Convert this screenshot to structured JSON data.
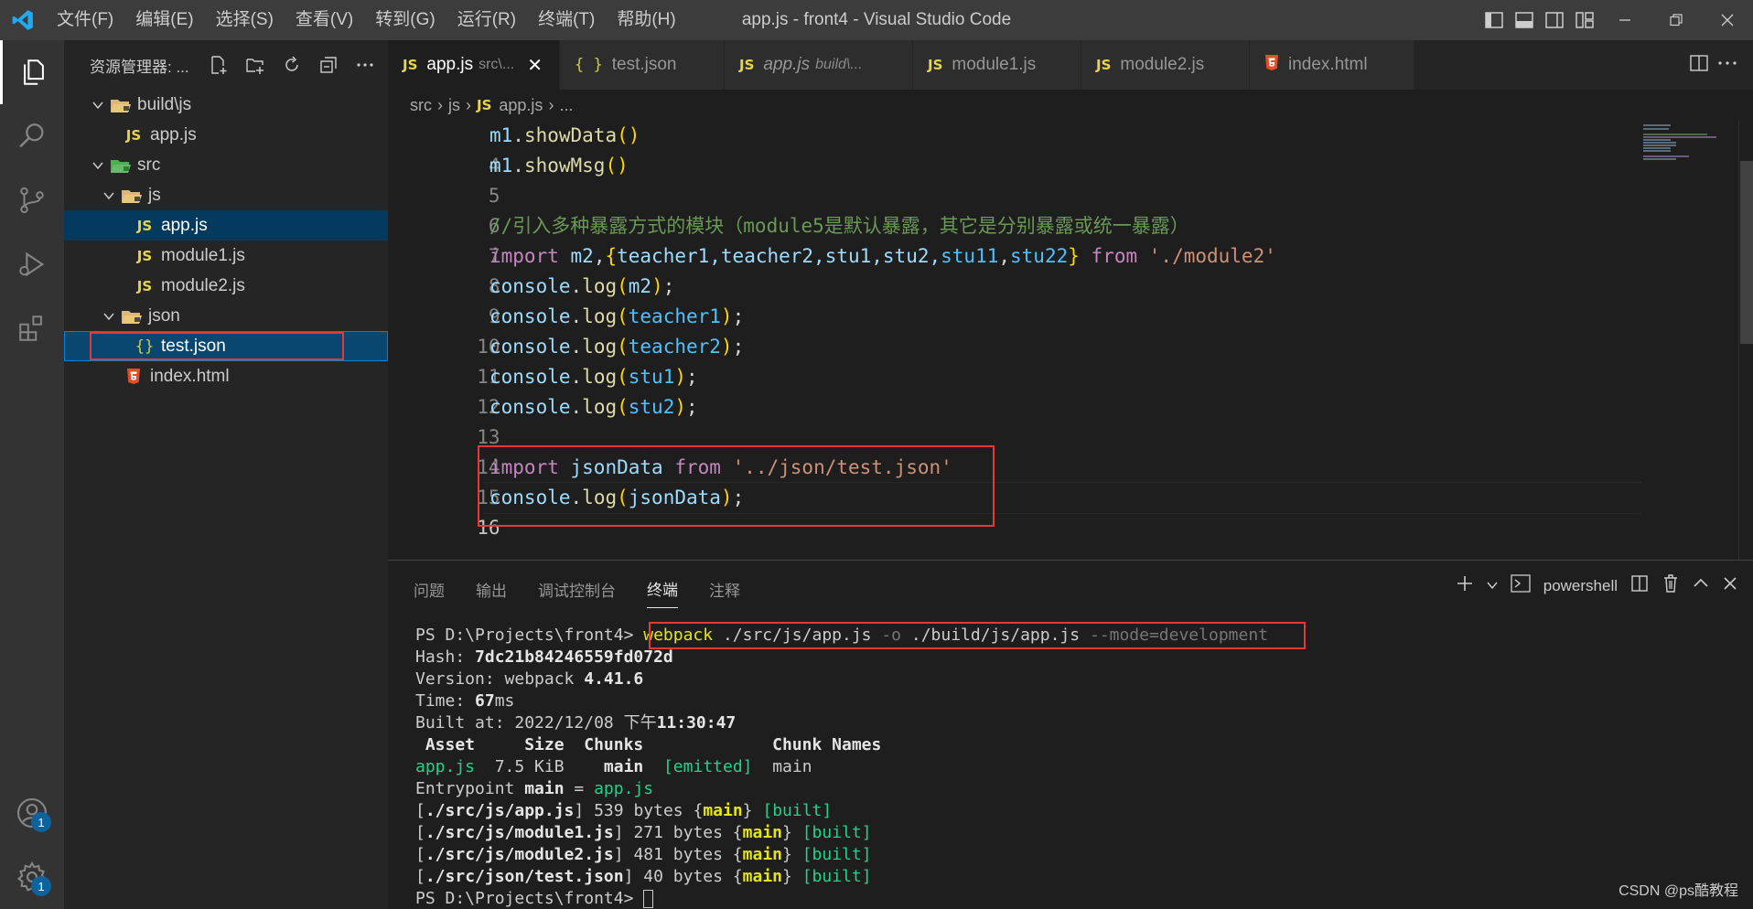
{
  "window": {
    "title": "app.js - front4 - Visual Studio Code"
  },
  "menu": [
    "文件(F)",
    "编辑(E)",
    "选择(S)",
    "查看(V)",
    "转到(G)",
    "运行(R)",
    "终端(T)",
    "帮助(H)"
  ],
  "activity": {
    "accounts_badge": "1",
    "settings_badge": "1"
  },
  "explorer": {
    "title": "资源管理器: ...",
    "tree": [
      {
        "label": "build\\js",
        "kind": "folder",
        "expanded": true
      },
      {
        "label": "app.js",
        "kind": "js"
      },
      {
        "label": "src",
        "kind": "folder",
        "expanded": true
      },
      {
        "label": "js",
        "kind": "folder",
        "expanded": true
      },
      {
        "label": "app.js",
        "kind": "js",
        "state": "selected"
      },
      {
        "label": "module1.js",
        "kind": "js"
      },
      {
        "label": "module2.js",
        "kind": "js"
      },
      {
        "label": "json",
        "kind": "folder",
        "expanded": true
      },
      {
        "label": "test.json",
        "kind": "json",
        "state": "focused"
      },
      {
        "label": "index.html",
        "kind": "html"
      }
    ]
  },
  "tabs": [
    {
      "icon": "JS",
      "name": "app.js",
      "desc": "src\\...",
      "active": true,
      "close": "✕"
    },
    {
      "icon": "{ }",
      "name": "test.json",
      "desc": ""
    },
    {
      "icon": "JS",
      "name": "app.js",
      "desc": "build\\...",
      "italic": true
    },
    {
      "icon": "JS",
      "name": "module1.js",
      "desc": ""
    },
    {
      "icon": "JS",
      "name": "module2.js",
      "desc": ""
    },
    {
      "icon": "5",
      "name": "index.html",
      "desc": ""
    }
  ],
  "breadcrumb": {
    "p1": "src",
    "p2": "js",
    "icon": "JS",
    "file": "app.js",
    "more": "..."
  },
  "editor": {
    "line_numbers": [
      "4",
      "5",
      "6",
      "7",
      "8",
      "9",
      "10",
      "11",
      "12",
      "13",
      "14",
      "15",
      "16"
    ],
    "l4": {
      "obj": "m1",
      "dot": ".",
      "fn": "showData",
      "args": "()"
    },
    "l5": {
      "obj": "m1",
      "dot": ".",
      "fn": "showMsg",
      "args": "()"
    },
    "l7": {
      "comment": "//引入多种暴露方式的模块（module5是默认暴露，其它是分别暴露或统一暴露）"
    },
    "l8": {
      "kw": "import",
      "sp1": " ",
      "def": "m2",
      "comma": ",",
      "ob": "{",
      "names": "teacher1,teacher2,stu1,stu2,",
      "n11": "stu11",
      "c2": ",",
      "n22": "stu22",
      "cb": "}",
      "sp2": " ",
      "from": "from",
      "sp3": " ",
      "path": "'./module2'"
    },
    "l9": {
      "obj": "console",
      "dot": ".",
      "fn": "log",
      "op": "(",
      "arg": "m2",
      "cp": ")",
      "semi": ";"
    },
    "l10": {
      "obj": "console",
      "dot": ".",
      "fn": "log",
      "op": "(",
      "arg": "teacher1",
      "cp": ")",
      "semi": ";"
    },
    "l11": {
      "obj": "console",
      "dot": ".",
      "fn": "log",
      "op": "(",
      "arg": "teacher2",
      "cp": ")",
      "semi": ";"
    },
    "l12": {
      "obj": "console",
      "dot": ".",
      "fn": "log",
      "op": "(",
      "arg": "stu1",
      "cp": ")",
      "semi": ";"
    },
    "l13": {
      "obj": "console",
      "dot": ".",
      "fn": "log",
      "op": "(",
      "arg": "stu2",
      "cp": ")",
      "semi": ";"
    },
    "l15": {
      "kw": "import",
      "sp1": " ",
      "name": "jsonData",
      "sp2": " ",
      "from": "from",
      "sp3": " ",
      "path": "'../json/test.json'"
    },
    "l16": {
      "obj": "console",
      "dot": ".",
      "fn": "log",
      "op": "(",
      "arg": "jsonData",
      "cp": ")",
      "semi": ";"
    }
  },
  "panel": {
    "tabs": [
      "问题",
      "输出",
      "调试控制台",
      "终端",
      "注释"
    ],
    "shell": "powershell",
    "terminal": {
      "prompt": "PS D:\\Projects\\front4> ",
      "cmd": "webpack",
      "cmd_a": " ./src/js/app.js ",
      "cmd_o": "-o",
      "cmd_b": " ./build/js/app.js ",
      "cmd_mode": "--mode=development",
      "hash_label": "Hash: ",
      "hash": "7dc21b84246559fd072d",
      "version_label": "Version: webpack ",
      "version": "4.41.6",
      "time_label": "Time: ",
      "time": "67",
      "time_unit": "ms",
      "built_label": "Built at: 2022/12/08 ",
      "built_pm": "下午",
      "built_time": "11:30:47",
      "table_header": " Asset     Size  Chunks             Chunk Names",
      "asset": "app.js",
      "asset_size": "  7.5 KiB    ",
      "asset_chunk": "main",
      "asset_gap": "  ",
      "emitted": "[emitted]",
      "asset_name": "  main",
      "entry_label": "Entrypoint ",
      "entry_main": "main",
      "entry_eq": " = ",
      "entry_file": "app.js",
      "modules": [
        {
          "open": "[",
          "path": "./src/js/app.js",
          "close": "] ",
          "size": "539 bytes {",
          "chunk": "main",
          "end": "} ",
          "built": "[built]"
        },
        {
          "open": "[",
          "path": "./src/js/module1.js",
          "close": "] ",
          "size": "271 bytes {",
          "chunk": "main",
          "end": "} ",
          "built": "[built]"
        },
        {
          "open": "[",
          "path": "./src/js/module2.js",
          "close": "] ",
          "size": "481 bytes {",
          "chunk": "main",
          "end": "} ",
          "built": "[built]"
        },
        {
          "open": "[",
          "path": "./src/json/test.json",
          "close": "] ",
          "size": "40 bytes {",
          "chunk": "main",
          "end": "} ",
          "built": "[built]"
        }
      ]
    }
  },
  "watermark": "CSDN @ps酷教程"
}
